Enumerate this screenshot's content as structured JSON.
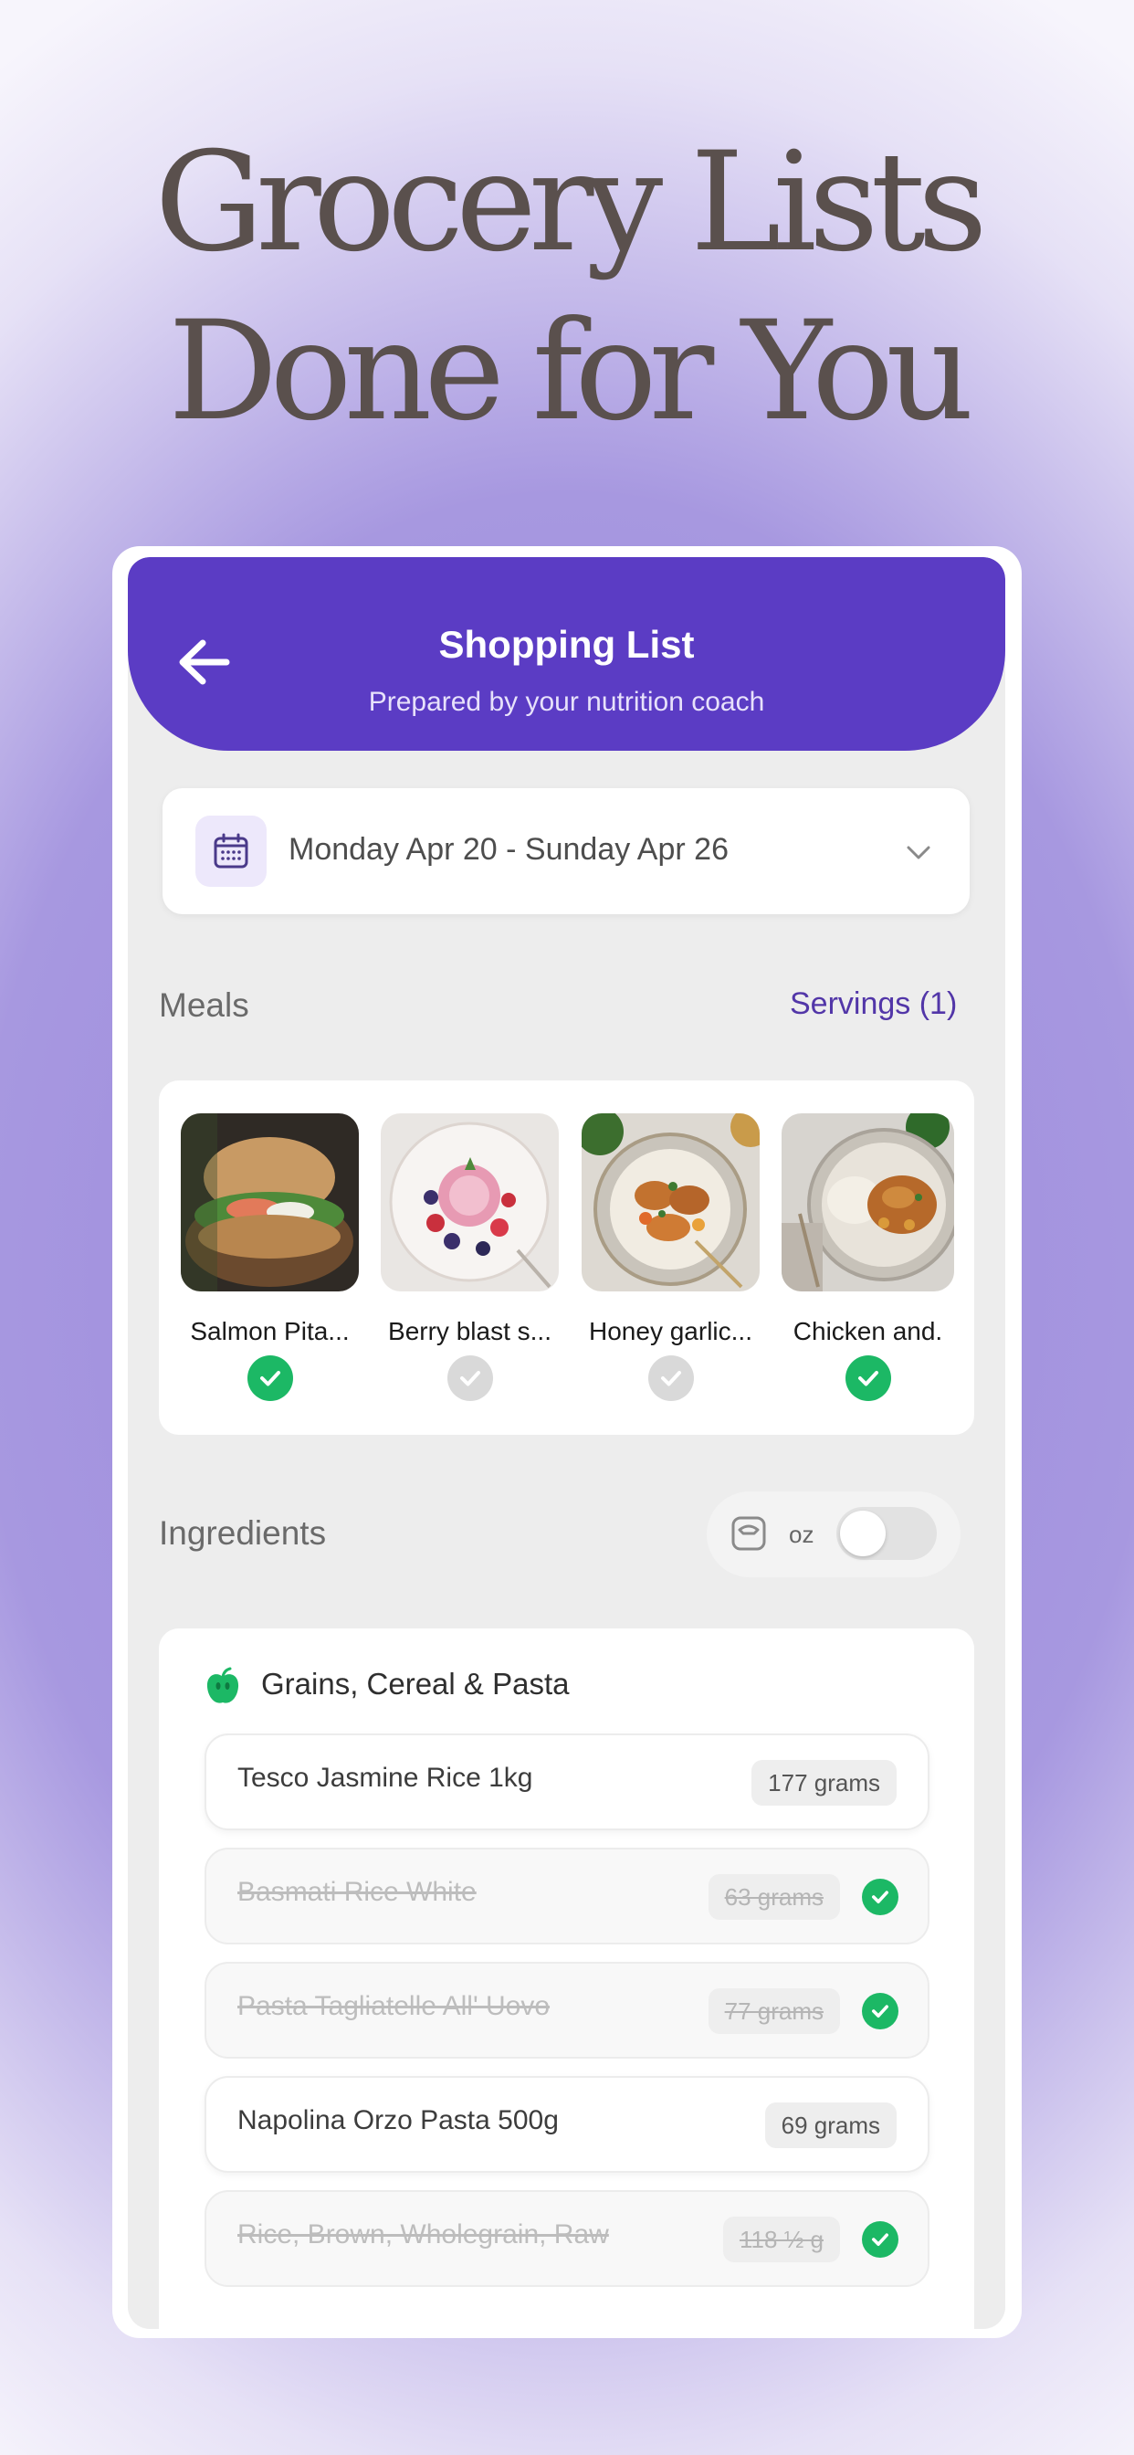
{
  "headline": {
    "line1": "Grocery Lists",
    "line2": "Done for You"
  },
  "header": {
    "title": "Shopping List",
    "subtitle": "Prepared by your nutrition coach",
    "back_icon": "arrow-left-icon"
  },
  "date_range": {
    "label": "Monday Apr 20 - Sunday Apr 26",
    "icon": "calendar-icon"
  },
  "meals": {
    "label": "Meals",
    "servings": "Servings (1)",
    "items": [
      {
        "name": "Salmon Pita...",
        "selected": true
      },
      {
        "name": "Berry blast s...",
        "selected": false
      },
      {
        "name": "Honey garlic...",
        "selected": false
      },
      {
        "name": "Chicken and.",
        "selected": true
      }
    ]
  },
  "ingredients": {
    "label": "Ingredients",
    "units_label": "oz",
    "units_toggle_on": false,
    "category": {
      "name": "Grains, Cereal & Pasta",
      "icon": "apple-icon",
      "items": [
        {
          "name": "Tesco Jasmine Rice 1kg",
          "qty": "177 grams",
          "checked": false
        },
        {
          "name": "Basmati Rice White",
          "qty": "63 grams",
          "checked": true
        },
        {
          "name": "Pasta Tagliatelle All' Uovo",
          "qty": "77 grams",
          "checked": true
        },
        {
          "name": "Napolina Orzo Pasta 500g",
          "qty": "69 grams",
          "checked": false
        },
        {
          "name": "Rice, Brown, Wholegrain, Raw",
          "qty": "118 ½ g",
          "checked": true
        }
      ]
    }
  },
  "colors": {
    "accent": "#5b3cc4",
    "check_green": "#1cb865",
    "headline": "#5a504d"
  }
}
